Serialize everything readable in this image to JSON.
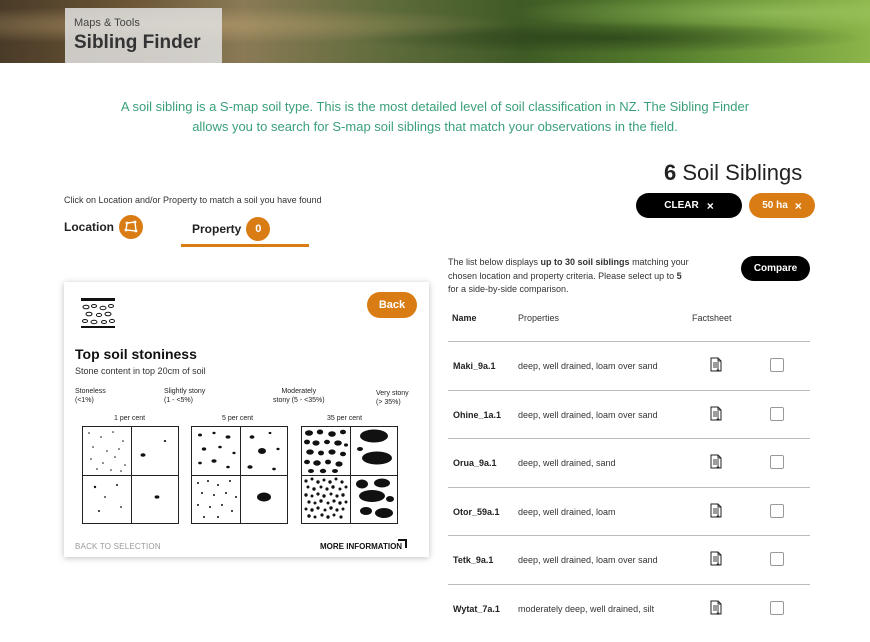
{
  "header": {
    "subtitle": "Maps & Tools",
    "title": "Sibling Finder"
  },
  "intro": "A soil sibling is a S-map soil type. This is the most detailed level of soil classification in NZ. The Sibling Finder allows you to search for S-map soil siblings that match your observations in the field.",
  "results": {
    "count": "6",
    "label": "Soil Siblings"
  },
  "buttons": {
    "clear": "CLEAR",
    "clear_icon": "×",
    "area": "50 ha",
    "area_icon": "×",
    "back": "Back",
    "compare": "Compare"
  },
  "hint": "Click on Location and/or Property to match a soil you have found",
  "tabs": {
    "location": {
      "label": "Location",
      "icon": "map-polygon-icon"
    },
    "property": {
      "label": "Property",
      "badge": "0"
    }
  },
  "panel": {
    "title": "Top soil stoniness",
    "description": "Stone content in top 20cm of soil",
    "categories": [
      {
        "name": "Stoneless",
        "range": "(<1%)"
      },
      {
        "name": "Slightly stony",
        "range": "(1 - <5%)"
      },
      {
        "name": "Moderately",
        "range": "stony (5 - <35%)"
      },
      {
        "name": "Very stony",
        "range": "(> 35%)"
      }
    ],
    "percents": [
      "1 per cent",
      "5 per cent",
      "35 per cent"
    ],
    "back_link": "BACK TO SELECTION",
    "more_link": "MORE INFORMATION"
  },
  "list_info": {
    "part1": "The list below displays ",
    "bold1": "up to 30 soil siblings",
    "part2": " matching your chosen location and property criteria. Please select up to ",
    "bold2": "5",
    "part3": " for a side-by-side comparison."
  },
  "table": {
    "headers": {
      "name": "Name",
      "properties": "Properties",
      "factsheet": "Factsheet"
    },
    "rows": [
      {
        "name": "Maki_9a.1",
        "properties": "deep, well drained, loam over sand"
      },
      {
        "name": "Ohine_1a.1",
        "properties": "deep, well drained, loam over sand"
      },
      {
        "name": "Orua_9a.1",
        "properties": "deep, well drained, sand"
      },
      {
        "name": "Otor_59a.1",
        "properties": "deep, well drained, loam"
      },
      {
        "name": "Tetk_9a.1",
        "properties": "deep, well drained, loam over sand"
      },
      {
        "name": "Wytat_7a.1",
        "properties": "moderately deep, well drained, silt"
      }
    ]
  },
  "colors": {
    "accent": "#d97c14",
    "intro_text": "#3aa07a",
    "dark_button": "#000000"
  }
}
